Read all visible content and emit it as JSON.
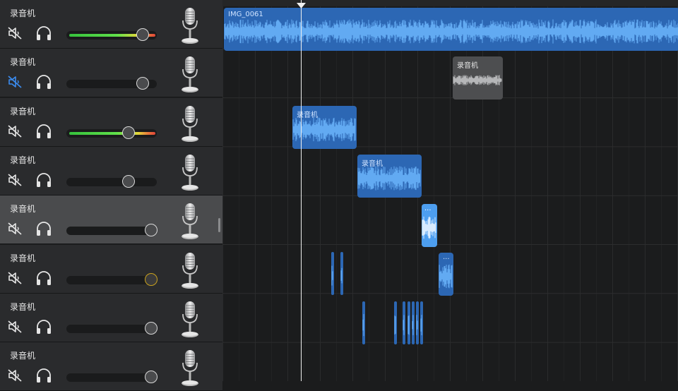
{
  "tracks": [
    {
      "name": "录音机",
      "muted": false,
      "fader_level": 0.84,
      "meter": true,
      "selected": false
    },
    {
      "name": "录音机",
      "muted": true,
      "fader_level": 0.84,
      "meter": false,
      "selected": false
    },
    {
      "name": "录音机",
      "muted": false,
      "fader_level": 0.69,
      "meter": true,
      "selected": false
    },
    {
      "name": "录音机",
      "muted": false,
      "fader_level": 0.69,
      "meter": false,
      "selected": false
    },
    {
      "name": "录音机",
      "muted": false,
      "fader_level": 0.94,
      "meter": false,
      "selected": true
    },
    {
      "name": "录音机",
      "muted": false,
      "fader_level": 0.94,
      "meter": false,
      "selected": false,
      "knob_state": "warning"
    },
    {
      "name": "录音机",
      "muted": false,
      "fader_level": 0.94,
      "meter": false,
      "selected": false
    },
    {
      "name": "录音机",
      "muted": false,
      "fader_level": 0.94,
      "meter": false,
      "selected": false
    }
  ],
  "regions": [
    {
      "label": "IMG_0061",
      "track": 0,
      "color": "blue"
    },
    {
      "label": "录音机",
      "track": 1,
      "color": "gray"
    },
    {
      "label": "录音机",
      "track": 2,
      "color": "blue"
    },
    {
      "label": "录音机",
      "track": 3,
      "color": "blue"
    },
    {
      "label": "···",
      "track": 4,
      "color": "blue-bright"
    },
    {
      "label": "···",
      "track": 5,
      "color": "blue"
    }
  ],
  "icons": {
    "mute": "speaker-muted-icon",
    "solo": "headphones-icon",
    "instrument": "microphone-icon"
  },
  "colors": {
    "region_blue": "#2c67b4",
    "region_blue_bright": "#4d9eef",
    "region_gray": "#4d4e50",
    "mute_active": "#3b8cf0",
    "wave_blue": "#62aaf2",
    "meter_green": "#4fd048",
    "meter_red": "#e04438"
  }
}
